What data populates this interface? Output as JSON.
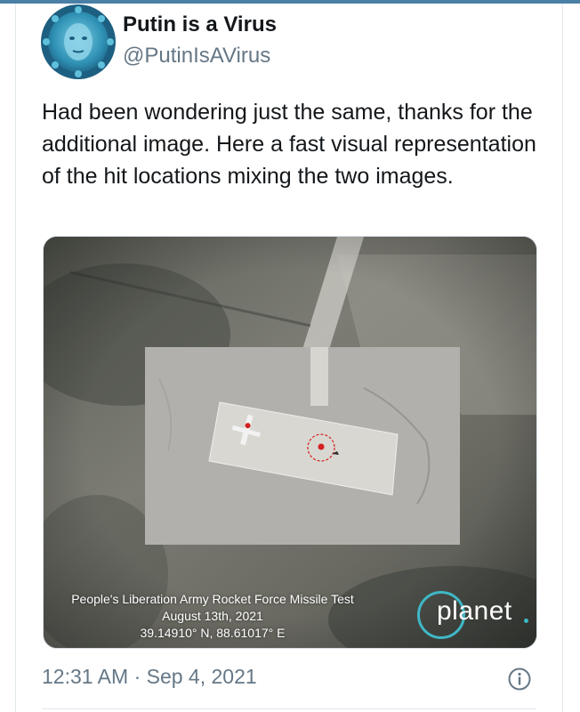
{
  "author": {
    "display_name": "Putin is a Virus",
    "handle": "@PutinIsAVirus",
    "avatar_icon": "virus-avatar"
  },
  "tweet": {
    "text": "Had been wondering just the same, thanks for the additional image. Here a fast visual representation of the hit locations mixing the two images."
  },
  "media": {
    "caption_line1": "People's Liberation Army Rocket Force Missile Test",
    "caption_line2": "August 13th, 2021",
    "caption_line3": "39.14910° N, 88.61017° E",
    "watermark": "planet",
    "watermark_accent": "#3fb8c6"
  },
  "footer": {
    "timestamp": "12:31 AM · Sep 4, 2021",
    "info_icon": "info-icon"
  },
  "colors": {
    "text_primary": "#14171a",
    "text_secondary": "#657786",
    "border": "#e1e8ed",
    "top_bar": "#4a7fa6"
  }
}
